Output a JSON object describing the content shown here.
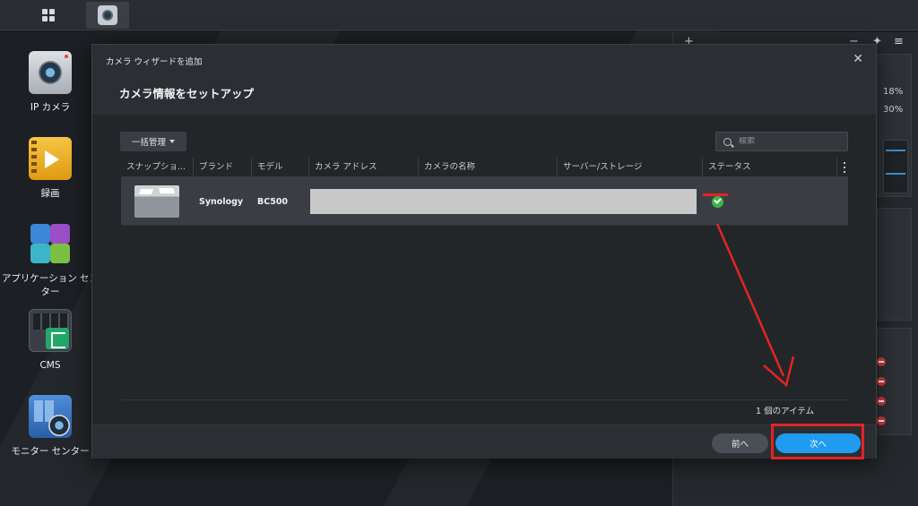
{
  "desktop": {
    "icons": [
      {
        "label": "IP カメラ"
      },
      {
        "label": "録画"
      },
      {
        "label": "アプリケーション センター"
      },
      {
        "label": "CMS"
      },
      {
        "label": "モニター センター"
      }
    ]
  },
  "widgets": {
    "pct1": "18%",
    "pct2": "30%"
  },
  "dialog": {
    "window_title": "カメラ ウィザードを追加",
    "heading": "カメラ情報をセットアップ",
    "bulk_button": "一括管理",
    "search_placeholder": "検索",
    "columns": [
      "スナップショ...",
      "ブランド",
      "モデル",
      "カメラ アドレス",
      "カメラの名称",
      "サーバー/ストレージ",
      "ステータス"
    ],
    "rows": [
      {
        "brand": "Synology",
        "model": "BC500",
        "status": "ok"
      }
    ],
    "item_count": "1 個のアイテム",
    "prev_button": "前へ",
    "next_button": "次へ"
  },
  "colors": {
    "accent": "#1f9bf0",
    "annotation": "#e32424",
    "status_ok": "#3bb54a"
  }
}
